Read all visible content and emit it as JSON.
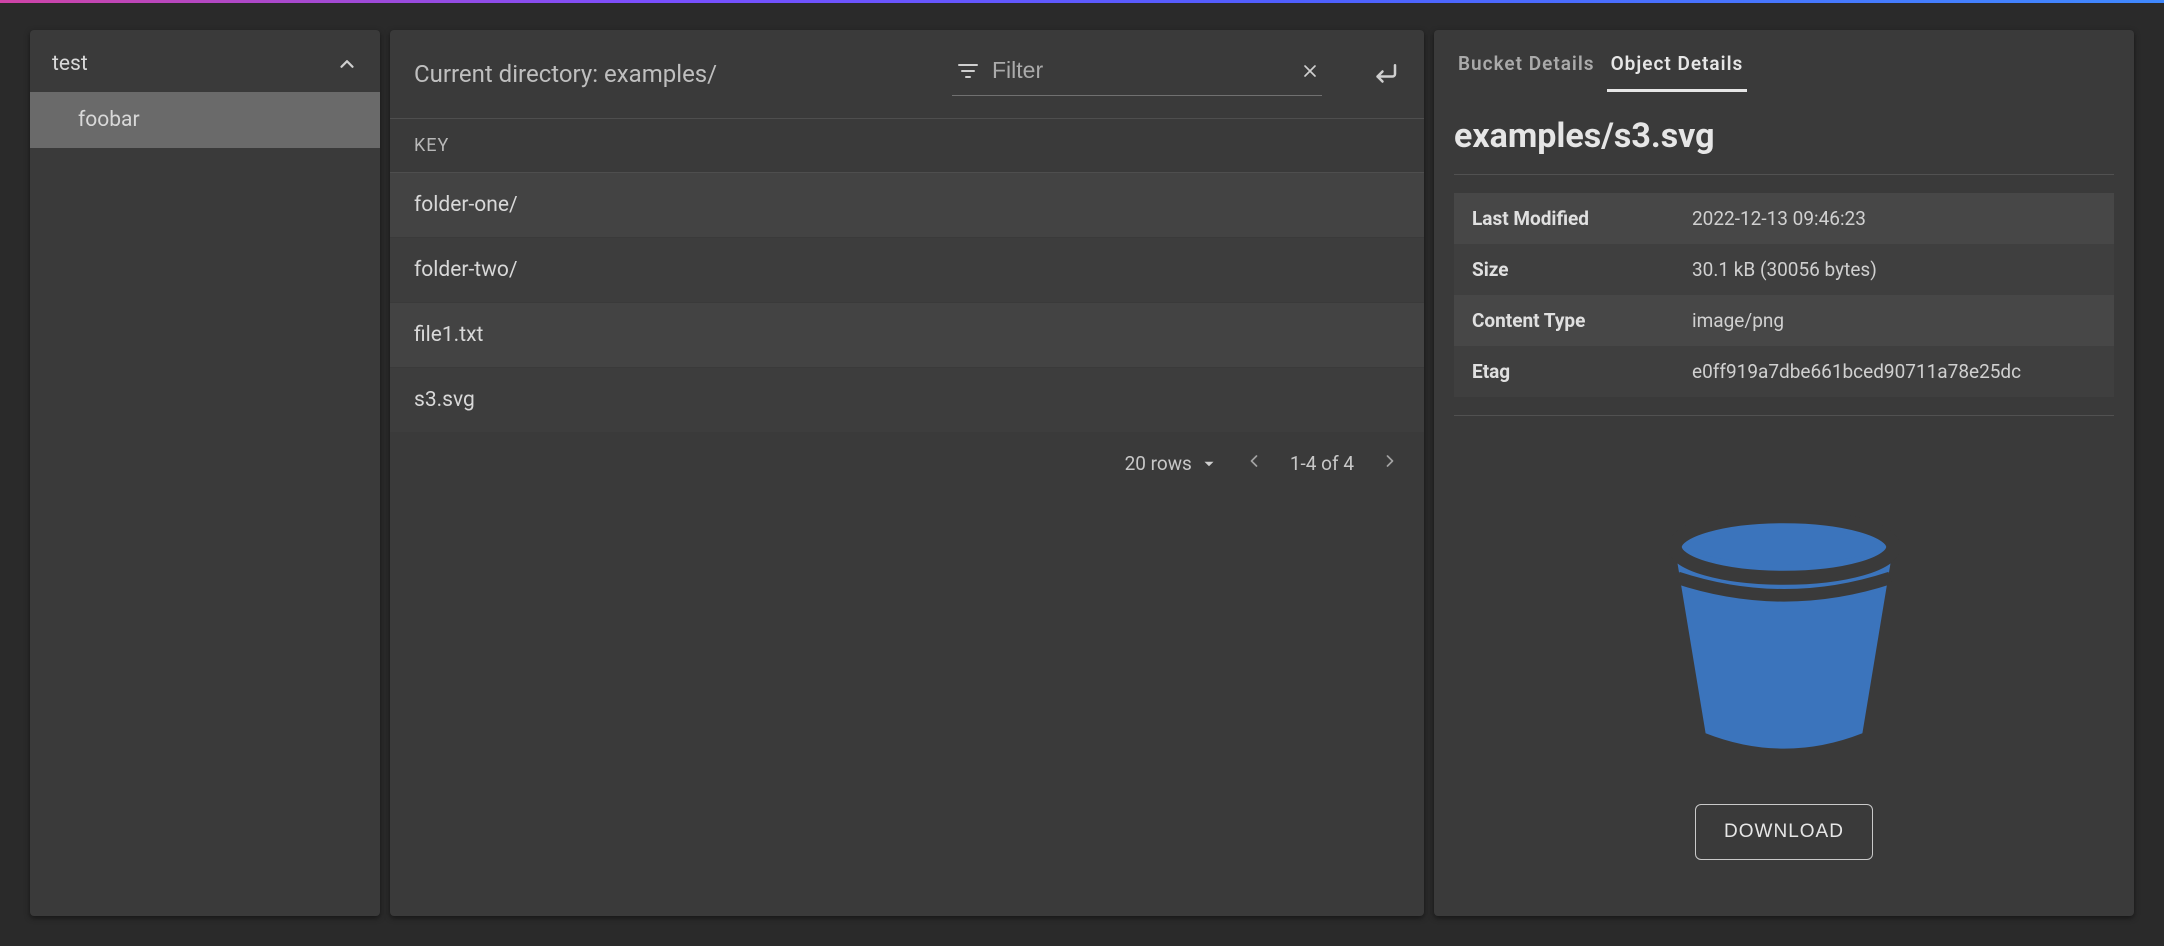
{
  "sidebar": {
    "root_label": "test",
    "items": [
      "foobar"
    ]
  },
  "toolbar": {
    "current_directory_label": "Current directory: examples/",
    "filter_placeholder": "Filter"
  },
  "table": {
    "header": "KEY",
    "rows": [
      "folder-one/",
      "folder-two/",
      "file1.txt",
      "s3.svg"
    ]
  },
  "pager": {
    "rows_label": "20 rows",
    "range_label": "1-4 of 4"
  },
  "details": {
    "tabs": {
      "bucket": "Bucket Details",
      "object": "Object Details",
      "active": "object"
    },
    "title": "examples/s3.svg",
    "kv": [
      {
        "k": "Last Modified",
        "v": "2022-12-13 09:46:23"
      },
      {
        "k": "Size",
        "v": "30.1 kB (30056 bytes)"
      },
      {
        "k": "Content Type",
        "v": "image/png"
      },
      {
        "k": "Etag",
        "v": "e0ff919a7dbe661bced90711a78e25dc"
      }
    ],
    "download_label": "DOWNLOAD"
  }
}
